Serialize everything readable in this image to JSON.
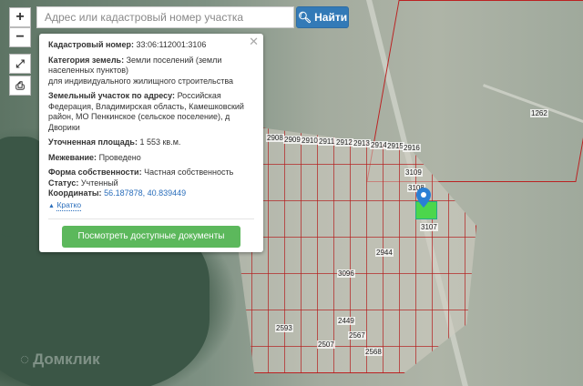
{
  "search": {
    "placeholder": "Адрес или кадастровый номер участка",
    "button_label": "Найти"
  },
  "controls": {
    "zoom_in": "+",
    "zoom_out": "−"
  },
  "popup": {
    "cadastral_label": "Кадастровый номер:",
    "cadastral_value": "33:06:112001:3106",
    "category_label": "Категория земель:",
    "category_value": "Земли поселений (земли населенных пунктов)",
    "category_use": "для индивидуального жилищного строительства",
    "address_label": "Земельный участок по адресу:",
    "address_value": "Российская Федерация, Владимирская область, Камешковский район, МО Пенкинское (сельское поселение), д Дворики",
    "area_label": "Уточненная площадь:",
    "area_value": "1 553 кв.м.",
    "survey_label": "Межевание:",
    "survey_value": "Проведено",
    "ownership_label": "Форма собственности:",
    "ownership_value": "Частная собственность",
    "status_label": "Статус:",
    "status_value": "Учтенный",
    "coords_label": "Координаты:",
    "coords_value": "56.187878, 40.839449",
    "collapse_label": "Кратко",
    "docs_button": "Посмотреть доступные документы"
  },
  "parcels": [
    "2908",
    "2909",
    "2910",
    "2911",
    "2912",
    "2913",
    "2914",
    "2915",
    "2916",
    "3109",
    "3108",
    "3107",
    "2944",
    "3096",
    "1262",
    "2449",
    "2507",
    "2567",
    "2568",
    "2593"
  ],
  "watermark": "Домклик",
  "colors": {
    "accent": "#337ab7",
    "docs_button": "#5cb85c",
    "parcel_border": "#b22222",
    "selected_parcel": "#4cd64c"
  }
}
